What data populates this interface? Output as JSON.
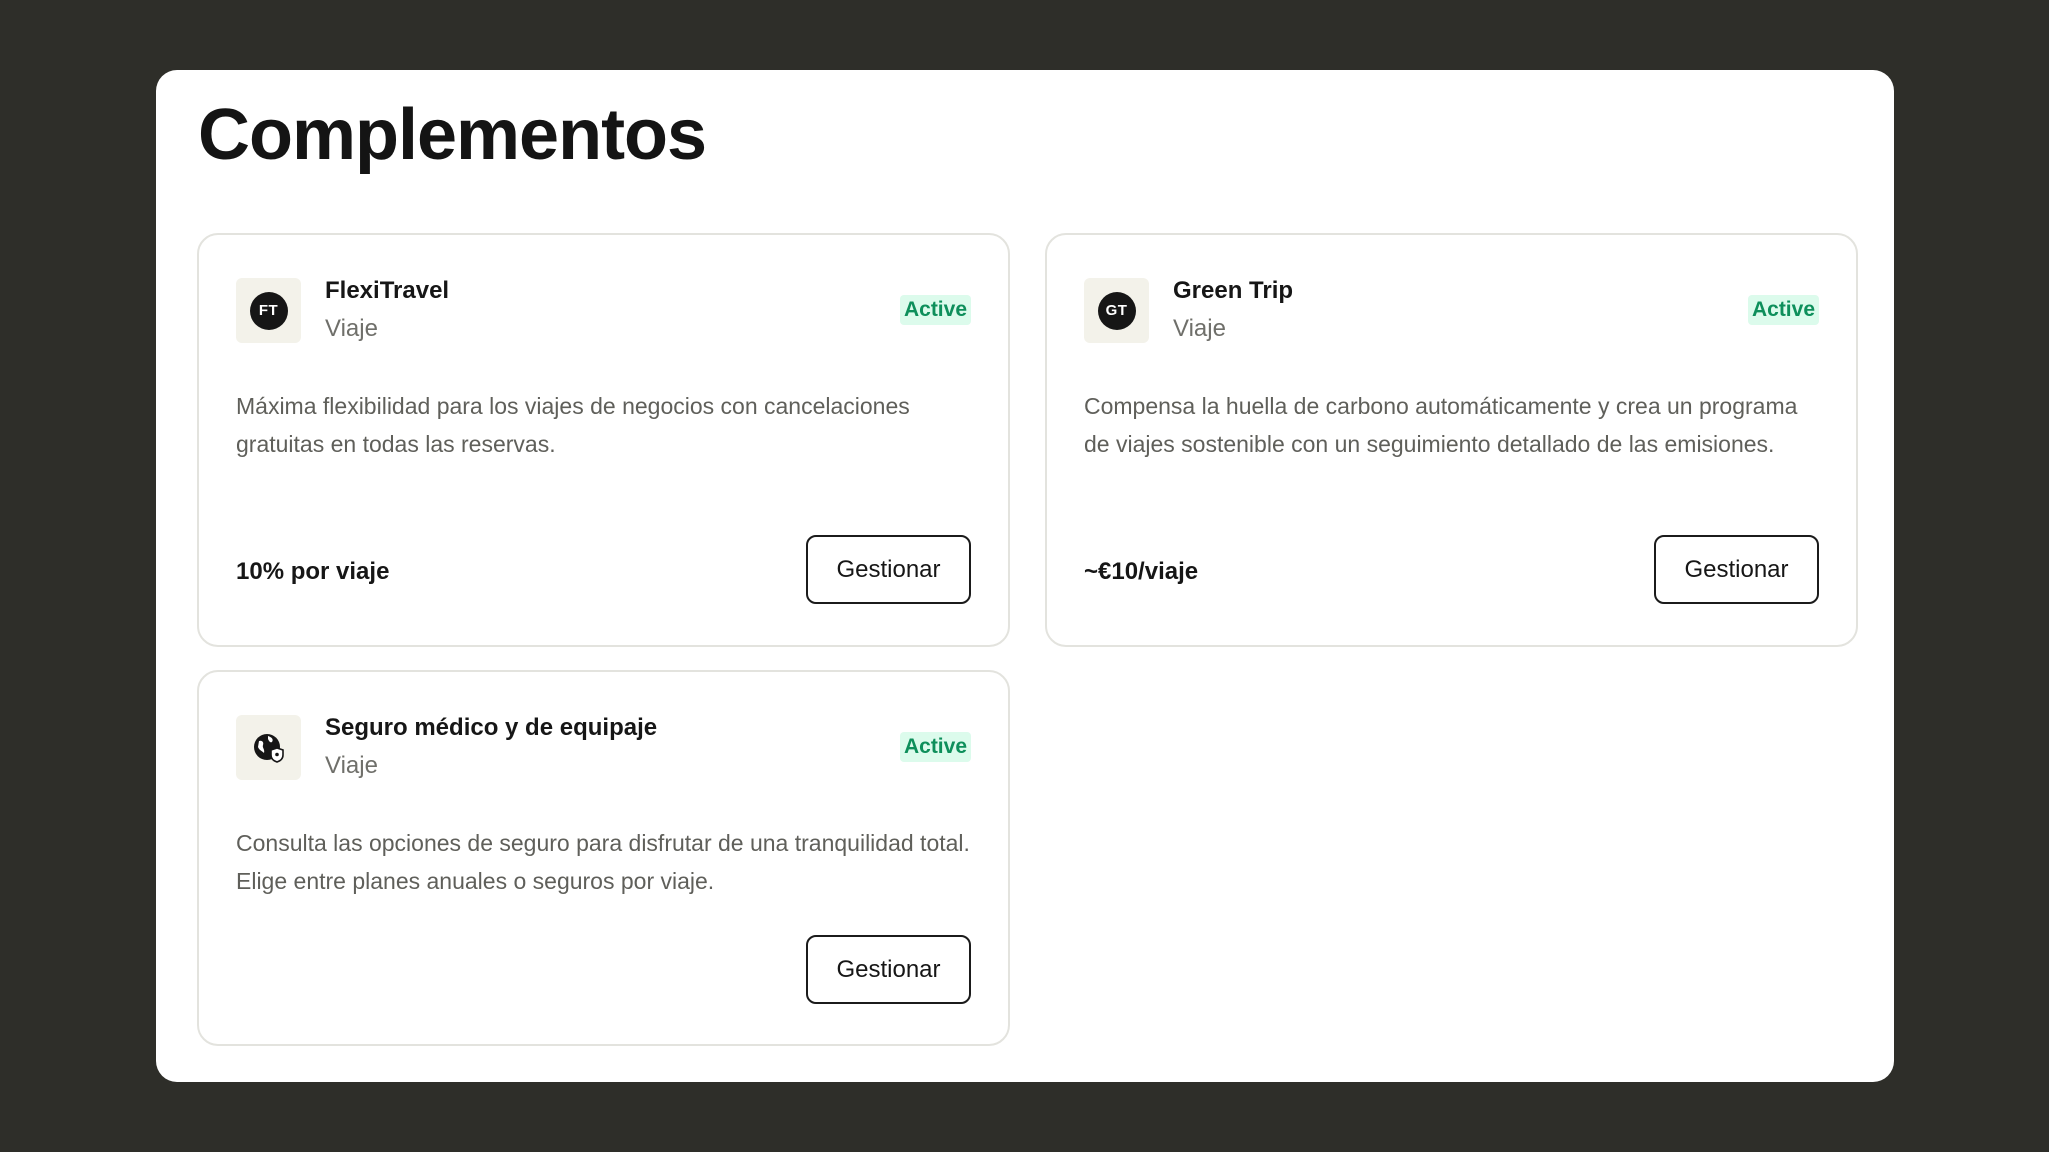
{
  "page": {
    "title": "Complementos"
  },
  "colors": {
    "background": "#2e2e29",
    "panel": "#ffffff",
    "badge_bg": "#dcfbec",
    "badge_text": "#0e8f5b",
    "logo_box": "#f3f2ea"
  },
  "addons": [
    {
      "logo_text": "FT",
      "name": "FlexiTravel",
      "category": "Viaje",
      "status": "Active",
      "description": "Máxima flexibilidad para los viajes de negocios con cancelaciones gratuitas en todas las reservas.",
      "price": "10% por viaje",
      "button_label": "Gestionar"
    },
    {
      "logo_text": "GT",
      "name": "Green Trip",
      "category": "Viaje",
      "status": "Active",
      "description": "Compensa la huella de carbono automáticamente y crea un programa de viajes sostenible con un seguimiento detallado de las emisiones.",
      "price": "~€10/viaje",
      "button_label": "Gestionar"
    },
    {
      "logo_icon": "globe-shield-icon",
      "name": "Seguro médico y de equipaje",
      "category": "Viaje",
      "status": "Active",
      "description": "Consulta las opciones de seguro para disfrutar de una tranquilidad total. Elige entre planes anuales o seguros por viaje.",
      "button_label": "Gestionar"
    }
  ]
}
